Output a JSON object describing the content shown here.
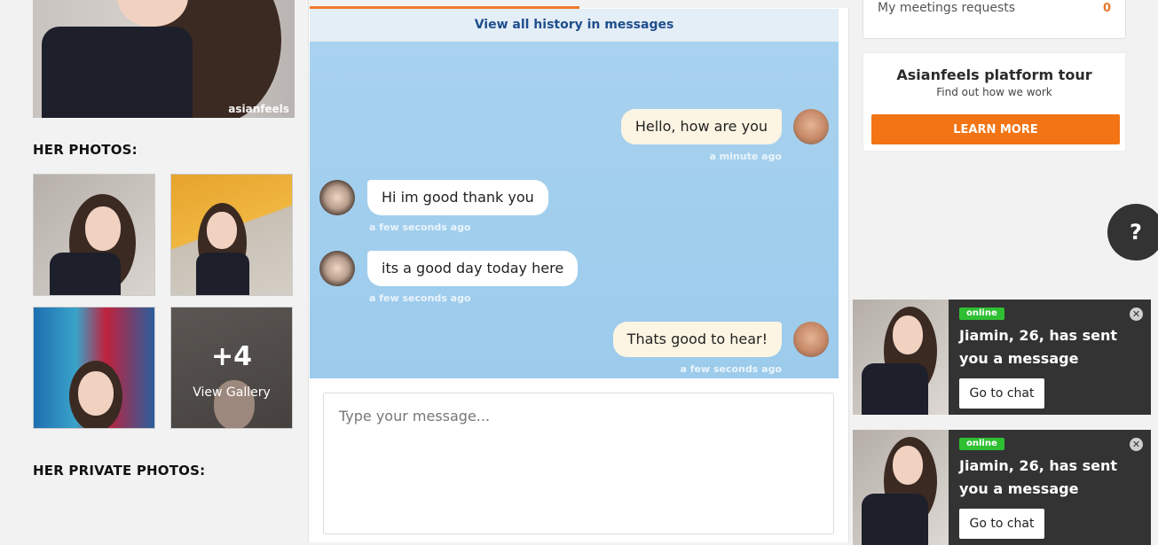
{
  "left": {
    "main_photo_watermark": "asianfeels",
    "her_photos_title": "HER PHOTOS:",
    "gallery": {
      "count": "+4",
      "label": "View Gallery"
    },
    "her_private_photos_title": "HER PRIVATE PHOTOS:"
  },
  "chat": {
    "history_link": "View all history in messages",
    "messages": [
      {
        "from": "me",
        "text": "Hello, how are you",
        "time": "a minute ago"
      },
      {
        "from": "her",
        "text": "Hi im good thank you",
        "time": "a few seconds ago"
      },
      {
        "from": "her",
        "text": "its a good day today here",
        "time": "a few seconds ago"
      },
      {
        "from": "me",
        "text": "Thats good to hear!",
        "time": "a few seconds ago"
      }
    ],
    "input_placeholder": "Type your message..."
  },
  "right": {
    "meetings": {
      "label": "My meetings requests",
      "count": "0"
    },
    "tour": {
      "title": "Asianfeels platform tour",
      "subtitle": "Find out how we work",
      "button": "LEARN MORE"
    },
    "help": "?"
  },
  "notifications": [
    {
      "status": "online",
      "text": "Jiamin, 26, has sent you a message",
      "button": "Go to chat"
    },
    {
      "status": "online",
      "text": "Jiamin, 26, has sent you a message",
      "button": "Go to chat"
    }
  ],
  "colors": {
    "accent": "#f37414",
    "link": "#1f4e8c",
    "chat_bg": "#a8d2ef",
    "online": "#2fbf33",
    "notif_bg": "#333333"
  },
  "icons": [
    "close-icon",
    "help-icon"
  ]
}
